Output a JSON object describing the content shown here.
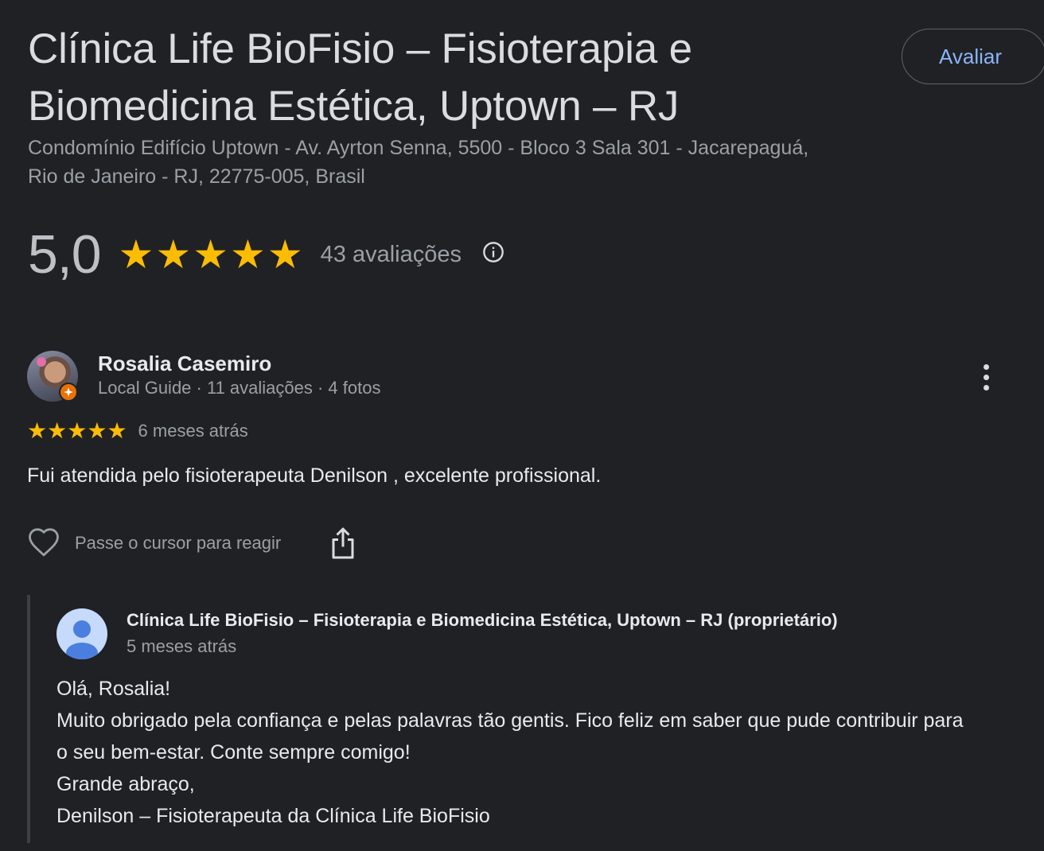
{
  "business": {
    "title": "Clínica Life BioFisio – Fisioterapia e Biomedicina Estética, Uptown – RJ",
    "address": "Condomínio Edifício Uptown - Av. Ayrton Senna, 5500 - Bloco 3 Sala 301 - Jacarepaguá, Rio de Janeiro - RJ, 22775-005, Brasil",
    "write_review_label": "Avaliar"
  },
  "summary": {
    "rating": "5,0",
    "stars": 5,
    "review_count": "43 avaliações",
    "info_icon": "info-icon"
  },
  "review": {
    "author": "Rosalia Casemiro",
    "meta": "Local Guide · 11 avaliações · 4 fotos",
    "stars": 5,
    "time": "6 meses atrás",
    "text": "Fui atendida pelo fisioterapeuta Denilson , excelente profissional.",
    "react_label": "Passe o cursor para reagir",
    "more_icon": "more-vert-icon",
    "like_icon": "heart-icon",
    "share_icon": "share-icon"
  },
  "reply": {
    "author": "Clínica Life BioFisio – Fisioterapia e Biomedicina Estética, Uptown – RJ (proprietário)",
    "time": "5 meses atrás",
    "lines": [
      "Olá, Rosalia!",
      "Muito obrigado pela confiança e pelas palavras tão gentis. Fico feliz em saber que pude contribuir para o seu bem-estar. Conte sempre comigo!",
      "Grande abraço,",
      "Denilson – Fisioterapeuta da Clínica Life BioFisio"
    ]
  },
  "colors": {
    "background": "#202124",
    "star": "#fbbc04",
    "link": "#8ab4f8",
    "secondary_text": "#9aa0a6",
    "local_guide_badge": "#e8710a"
  }
}
